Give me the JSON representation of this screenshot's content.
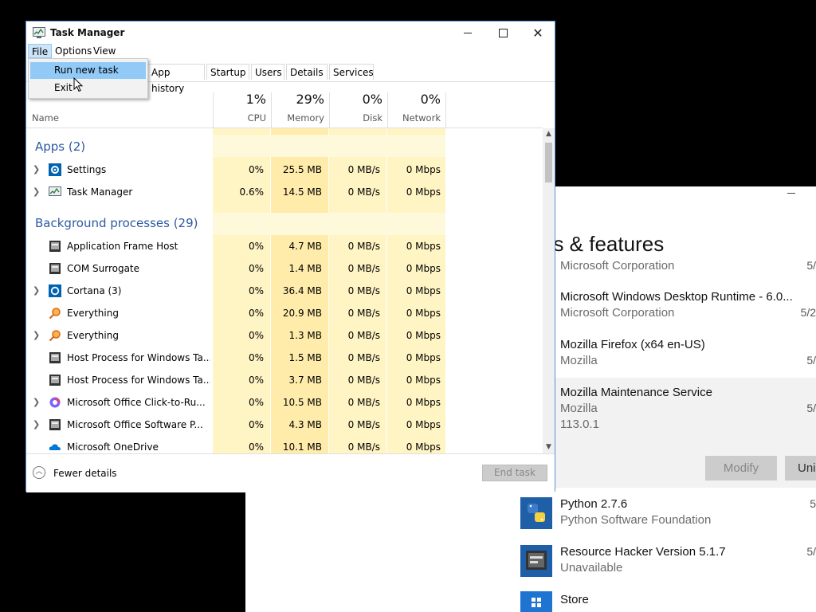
{
  "settings_window": {
    "title": "ps & features",
    "apps": [
      {
        "name": "",
        "publisher": "Microsoft Corporation",
        "date": "5/"
      },
      {
        "name": "Microsoft Windows Desktop Runtime - 6.0...",
        "publisher": "Microsoft Corporation",
        "date": "5/2"
      },
      {
        "name": "Mozilla Firefox (x64 en-US)",
        "publisher": "Mozilla",
        "date": "5/"
      },
      {
        "name": "Mozilla Maintenance Service",
        "publisher": "Mozilla",
        "version": "113.0.1",
        "date": "5/"
      },
      {
        "name": "Python 2.7.6",
        "publisher": "Python Software Foundation",
        "date": "5"
      },
      {
        "name": "Resource Hacker Version 5.1.7",
        "publisher": "Unavailable",
        "date": "5/"
      },
      {
        "name": "Store",
        "publisher": "",
        "date": ""
      }
    ],
    "modify_label": "Modify",
    "uninstall_label": "Uni"
  },
  "task_manager": {
    "title": "Task Manager",
    "menu": [
      "File",
      "Options",
      "View"
    ],
    "file_menu": [
      "Run new task",
      "Exit"
    ],
    "tabs": [
      "App history",
      "Startup",
      "Users",
      "Details",
      "Services"
    ],
    "name_header": "Name",
    "columns": [
      {
        "pct": "1%",
        "label": "CPU"
      },
      {
        "pct": "29%",
        "label": "Memory"
      },
      {
        "pct": "0%",
        "label": "Disk"
      },
      {
        "pct": "0%",
        "label": "Network"
      }
    ],
    "groups": {
      "apps": "Apps (2)",
      "background": "Background processes (29)"
    },
    "app_rows": [
      {
        "name": "Settings",
        "cpu": "0%",
        "mem": "25.5 MB",
        "disk": "0 MB/s",
        "net": "0 Mbps",
        "expandable": true
      },
      {
        "name": "Task Manager",
        "cpu": "0.6%",
        "mem": "14.5 MB",
        "disk": "0 MB/s",
        "net": "0 Mbps",
        "expandable": true
      }
    ],
    "bg_rows": [
      {
        "name": "Application Frame Host",
        "cpu": "0%",
        "mem": "4.7 MB",
        "disk": "0 MB/s",
        "net": "0 Mbps",
        "expandable": false
      },
      {
        "name": "COM Surrogate",
        "cpu": "0%",
        "mem": "1.4 MB",
        "disk": "0 MB/s",
        "net": "0 Mbps",
        "expandable": false
      },
      {
        "name": "Cortana (3)",
        "cpu": "0%",
        "mem": "36.4 MB",
        "disk": "0 MB/s",
        "net": "0 Mbps",
        "expandable": true
      },
      {
        "name": "Everything",
        "cpu": "0%",
        "mem": "20.9 MB",
        "disk": "0 MB/s",
        "net": "0 Mbps",
        "expandable": false
      },
      {
        "name": "Everything",
        "cpu": "0%",
        "mem": "1.3 MB",
        "disk": "0 MB/s",
        "net": "0 Mbps",
        "expandable": true
      },
      {
        "name": "Host Process for Windows Ta...",
        "cpu": "0%",
        "mem": "1.5 MB",
        "disk": "0 MB/s",
        "net": "0 Mbps",
        "expandable": false
      },
      {
        "name": "Host Process for Windows Ta...",
        "cpu": "0%",
        "mem": "3.7 MB",
        "disk": "0 MB/s",
        "net": "0 Mbps",
        "expandable": false
      },
      {
        "name": "Microsoft Office Click-to-Ru...",
        "cpu": "0%",
        "mem": "10.5 MB",
        "disk": "0 MB/s",
        "net": "0 Mbps",
        "expandable": true
      },
      {
        "name": "Microsoft Office Software P...",
        "cpu": "0%",
        "mem": "4.3 MB",
        "disk": "0 MB/s",
        "net": "0 Mbps",
        "expandable": true
      },
      {
        "name": "Microsoft OneDrive",
        "cpu": "0%",
        "mem": "10.1 MB",
        "disk": "0 MB/s",
        "net": "0 Mbps",
        "expandable": false
      }
    ],
    "fewer_details": "Fewer details",
    "end_task": "End task"
  }
}
